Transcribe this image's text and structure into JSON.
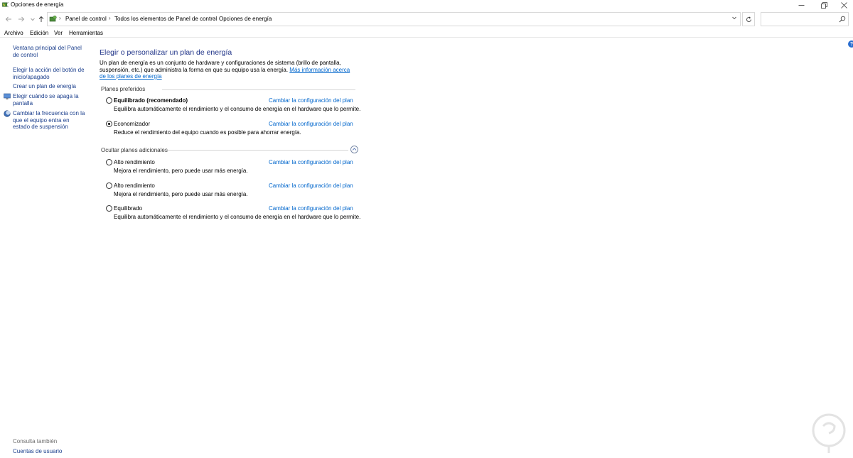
{
  "window": {
    "title": "Opciones de energía",
    "icon": "power-options-icon"
  },
  "address": {
    "crumbs": [
      "Panel de control",
      "Todos los elementos de Panel de control",
      "Opciones de energía"
    ],
    "search_placeholder": ""
  },
  "menu": {
    "items": [
      "Archivo",
      "Edición",
      "Ver",
      "Herramientas"
    ]
  },
  "sidebar": {
    "links": [
      "Ventana principal del Panel de control",
      "Elegir la acción del botón de inicio/apagado",
      "Crear un plan de energía",
      "Elegir cuándo se apaga la pantalla",
      "Cambiar la frecuencia con la que el equipo entra en estado de suspensión"
    ],
    "see_also_title": "Consulta también",
    "see_also_link": "Cuentas de usuario"
  },
  "main": {
    "heading": "Elegir o personalizar un plan de energía",
    "description": "Un plan de energía es un conjunto de hardware y configuraciones de sistema (brillo de pantalla, suspensión, etc.) que administra la forma en que su equipo usa la energía.",
    "description_link": "Más información acerca de los planes de energía",
    "preferred_label": "Planes preferidos",
    "additional_label": "Ocultar planes adicionales",
    "change_label": "Cambiar la configuración del plan",
    "preferred_plans": [
      {
        "name": "Equilibrado (recomendado)",
        "desc": "Equilibra automáticamente el rendimiento y el consumo de energía en el hardware que lo permite.",
        "selected": false
      },
      {
        "name": "Economizador",
        "desc": "Reduce el rendimiento del equipo cuando es posible para ahorrar energía.",
        "selected": true
      }
    ],
    "additional_plans": [
      {
        "name": "Alto rendimiento",
        "desc": "Mejora el rendimiento, pero puede usar más energía.",
        "selected": false
      },
      {
        "name": "Alto rendimiento",
        "desc": "Mejora el rendimiento, pero puede usar más energía.",
        "selected": false
      },
      {
        "name": "Equilibrado",
        "desc": "Equilibra automáticamente el rendimiento y el consumo de energía en el hardware que lo permite.",
        "selected": false
      }
    ]
  },
  "colors": {
    "heading": "#1e3287",
    "link": "#0066cc",
    "sidebar_link": "#1a3e8c"
  }
}
